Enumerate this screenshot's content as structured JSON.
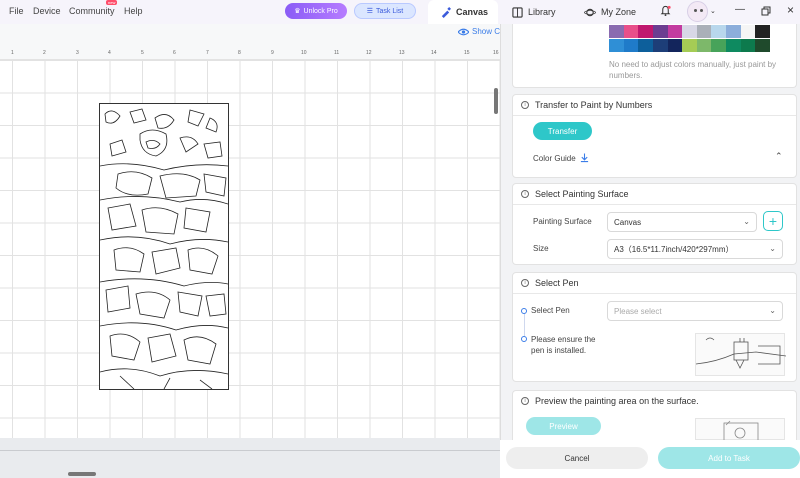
{
  "menu": [
    "File",
    "Device",
    "Community",
    "Help"
  ],
  "community_badge": "new",
  "pills": {
    "unlock": "Unlock Pro",
    "task": "Task List"
  },
  "tabs": [
    "Canvas",
    "Library",
    "My Zone"
  ],
  "canvas": {
    "show_label": "Show C",
    "ruler_ticks": [
      "1",
      "2",
      "3",
      "4",
      "5",
      "6",
      "7",
      "8",
      "9",
      "10",
      "11",
      "12",
      "13",
      "14",
      "15",
      "16"
    ]
  },
  "colors": {
    "teal": "#2ec7c9",
    "palette_row1": [
      "#8a6bb0",
      "#e84f8a",
      "#c0186f",
      "#6c3d91",
      "#c33ba0",
      "#d8d8e6",
      "#aab0b8",
      "#b8d7ec",
      "#8caedb",
      "#f5f5f5",
      "#222222"
    ],
    "palette_row2": [
      "#2f8fd6",
      "#1f7bc9",
      "#0d5f9b",
      "#1d3e78",
      "#13255c",
      "#a5cc55",
      "#7db86a",
      "#47a35a",
      "#0e8a60",
      "#0d7a4d",
      "#1f4a2c"
    ]
  },
  "panel": {
    "palette_note": "No need to adjust colors manually, just paint by numbers.",
    "transfer": {
      "title": "Transfer to Paint by Numbers",
      "button": "Transfer",
      "color_guide": "Color Guide"
    },
    "surface": {
      "title": "Select Painting Surface",
      "surface_label": "Painting Surface",
      "surface_value": "Canvas",
      "size_label": "Size",
      "size_value": "A3（16.5*11.7inch/420*297mm）"
    },
    "pen": {
      "title": "Select Pen",
      "pen_label": "Select Pen",
      "pen_placeholder": "Please select",
      "ensure_note": "Please ensure the pen is installed."
    },
    "preview": {
      "title": "Preview the painting area on the surface.",
      "button": "Preview"
    },
    "footer": {
      "cancel": "Cancel",
      "add": "Add to Task"
    }
  }
}
